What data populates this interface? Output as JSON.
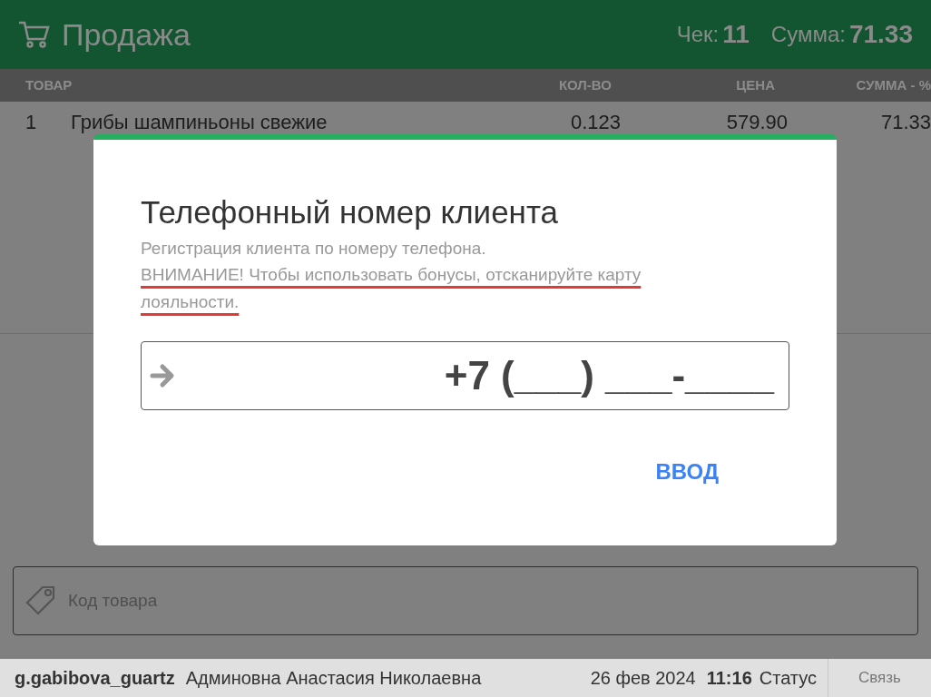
{
  "header": {
    "title": "Продажа",
    "receipt_label": "Чек:",
    "receipt_number": "11",
    "sum_label": "Сумма:",
    "sum_value": "71.33"
  },
  "table": {
    "columns": [
      "ТОВАР",
      "КОЛ-ВО",
      "ЦЕНА",
      "СУММА - %"
    ],
    "rows": [
      {
        "index": "1",
        "name": "Грибы шампиньоны свежие",
        "qty": "0.123",
        "price": "579.90",
        "sum": "71.33"
      }
    ]
  },
  "product_code": {
    "placeholder": "Код товара"
  },
  "status_bar": {
    "login": "g.gabibova_guartz",
    "user": "Админовна Анастасия Николаевна",
    "date": "26 фев 2024",
    "time": "11:16",
    "status": "Статус",
    "link_button": "Связь"
  },
  "dialog": {
    "title": "Телефонный номер клиента",
    "subtitle": "Регистрация клиента по номеру телефона.",
    "warning": "ВНИМАНИЕ! Чтобы использовать бонусы, отсканируйте карту лояльности.",
    "phone_value": "+7 (___) ___-____",
    "submit": "ВВОД"
  }
}
